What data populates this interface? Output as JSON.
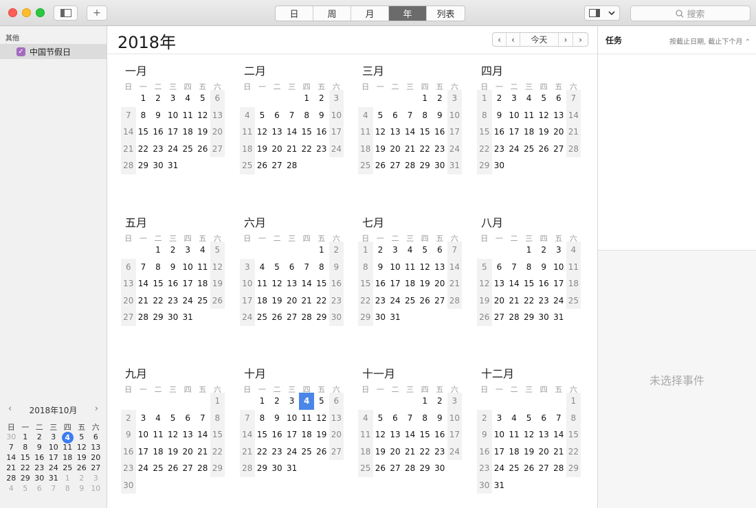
{
  "toolbar": {
    "add_label": "+",
    "views": [
      "日",
      "周",
      "月",
      "年",
      "列表"
    ],
    "active_view": "年",
    "search_placeholder": "搜索"
  },
  "sidebar": {
    "group_label": "其他",
    "calendars": [
      {
        "label": "中国节假日",
        "checked": true,
        "color": "#a56bbf"
      }
    ],
    "mini_calendar": {
      "title": "2018年10月",
      "weekdays": [
        "日",
        "一",
        "二",
        "三",
        "四",
        "五",
        "六"
      ],
      "weeks": [
        [
          "30",
          "1",
          "2",
          "3",
          "4",
          "5",
          "6"
        ],
        [
          "7",
          "8",
          "9",
          "10",
          "11",
          "12",
          "13"
        ],
        [
          "14",
          "15",
          "16",
          "17",
          "18",
          "19",
          "20"
        ],
        [
          "21",
          "22",
          "23",
          "24",
          "25",
          "26",
          "27"
        ],
        [
          "28",
          "29",
          "30",
          "31",
          "1",
          "2",
          "3"
        ],
        [
          "4",
          "5",
          "6",
          "7",
          "8",
          "9",
          "10"
        ]
      ],
      "today": "4"
    }
  },
  "main": {
    "year_title": "2018年",
    "today_label": "今天",
    "weekday_labels": [
      "日",
      "一",
      "二",
      "三",
      "四",
      "五",
      "六"
    ],
    "months": [
      {
        "name": "一月",
        "offset": 1,
        "days": 31
      },
      {
        "name": "二月",
        "offset": 4,
        "days": 28
      },
      {
        "name": "三月",
        "offset": 4,
        "days": 31
      },
      {
        "name": "四月",
        "offset": 0,
        "days": 30
      },
      {
        "name": "五月",
        "offset": 2,
        "days": 31
      },
      {
        "name": "六月",
        "offset": 5,
        "days": 30
      },
      {
        "name": "七月",
        "offset": 0,
        "days": 31
      },
      {
        "name": "八月",
        "offset": 3,
        "days": 31
      },
      {
        "name": "九月",
        "offset": 6,
        "days": 30
      },
      {
        "name": "十月",
        "offset": 1,
        "days": 31,
        "selected": 4
      },
      {
        "name": "十一月",
        "offset": 4,
        "days": 30
      },
      {
        "name": "十二月",
        "offset": 6,
        "days": 31
      }
    ]
  },
  "right_panel": {
    "tasks_title": "任务",
    "sort_label": "按截止日期, 截止下个月 ⌃",
    "empty_label": "未选择事件"
  },
  "colors": {
    "selected_day": "#4a86e8",
    "active_segment": "#6b6b6b"
  }
}
